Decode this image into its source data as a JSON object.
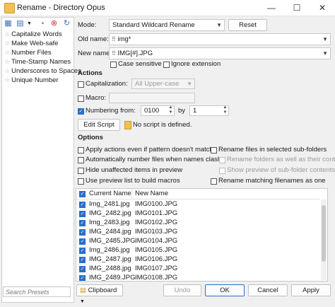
{
  "window": {
    "title": "Rename - Directory Opus"
  },
  "titlebar_buttons": {
    "minimize": "—",
    "maximize": "☐",
    "close": "✕"
  },
  "presets": {
    "items": [
      "Capitalize Words",
      "Make Web-safe",
      "Number Files",
      "Time-Stamp Names",
      "Underscores to Spaces",
      "Unique Number"
    ],
    "search_placeholder": "Search Presets"
  },
  "mode": {
    "label": "Mode:",
    "value": "Standard Wildcard Rename",
    "reset": "Reset"
  },
  "old_name": {
    "label": "Old name:",
    "value": "img*"
  },
  "new_name": {
    "label": "New name:",
    "value": "IMG[#].JPG"
  },
  "case_sensitive": "Case sensitive",
  "ignore_extension": "Ignore extension",
  "actions": {
    "title": "Actions",
    "capitalization_label": "Capitalization:",
    "capitalization_value": "All Upper-case",
    "macro_label": "Macro:",
    "numbering_label": "Numbering from:",
    "numbering_from": "0100",
    "by_label": "by",
    "by_value": "1",
    "edit_script": "Edit Script",
    "no_script": "No script is defined."
  },
  "options": {
    "title": "Options",
    "apply_actions": "Apply actions even if pattern doesn't match",
    "auto_number": "Automatically number files when names clash",
    "hide_unaffected": "Hide unaffected items in preview",
    "use_preview": "Use preview list to build macros",
    "rename_subfolders": "Rename files in selected sub-folders",
    "rename_folders_too": "Rename folders as well as their contents",
    "show_preview_sub": "Show preview of sub-folder contents",
    "rename_matching": "Rename matching filenames as one"
  },
  "file_list": {
    "col_current": "Current Name",
    "col_new": "New Name",
    "rows": [
      [
        "Img_2481.jpg",
        "IMG0100.JPG"
      ],
      [
        "IMG_2482.jpg",
        "IMG0101.JPG"
      ],
      [
        "Img_2483.jpg",
        "IMG0102.JPG"
      ],
      [
        "IMG_2484.jpg",
        "IMG0103.JPG"
      ],
      [
        "IMG_2485.JPG",
        "IMG0104.JPG"
      ],
      [
        "Img_2486.jpg",
        "IMG0105.JPG"
      ],
      [
        "IMG_2487.jpg",
        "IMG0106.JPG"
      ],
      [
        "IMG_2488.jpg",
        "IMG0107.JPG"
      ],
      [
        "IMG_2489.JPG",
        "IMG0108.JPG"
      ]
    ]
  },
  "bottom": {
    "clipboard": "Clipboard",
    "undo": "Undo",
    "ok": "OK",
    "cancel": "Cancel",
    "apply": "Apply"
  },
  "colors": {
    "accent": "#2a6fc9",
    "note_icon": "#f2c14e"
  }
}
